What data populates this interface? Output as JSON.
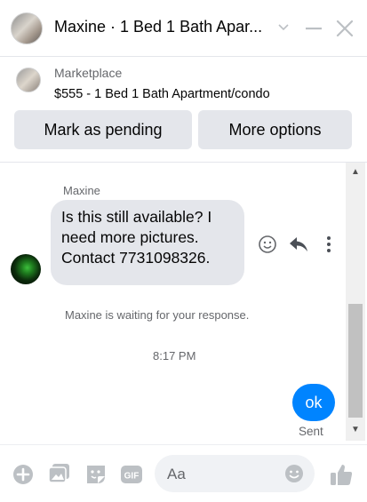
{
  "header": {
    "title": "Maxine · 1 Bed 1 Bath Apar...",
    "chevron_icon": "chevron-down-icon",
    "minimize_icon": "minimize-icon",
    "close_icon": "close-icon"
  },
  "listing": {
    "label": "Marketplace",
    "description": "$555 - 1 Bed 1 Bath Apartment/condo"
  },
  "actions": {
    "mark_pending": "Mark as pending",
    "more_options": "More options"
  },
  "conversation": {
    "sender_name": "Maxine",
    "received_message": "Is this still available? I need more pictures. Contact 7731098326.",
    "waiting_notice": "Maxine is waiting for your response.",
    "timestamp": "8:17 PM",
    "sent_message": "ok",
    "sent_status": "Sent"
  },
  "composer": {
    "placeholder": "Aa"
  },
  "colors": {
    "accent": "#0084ff",
    "bubble_gray": "#e4e6eb",
    "muted_text": "#65676b",
    "icon_gray": "#bcc0c4"
  }
}
